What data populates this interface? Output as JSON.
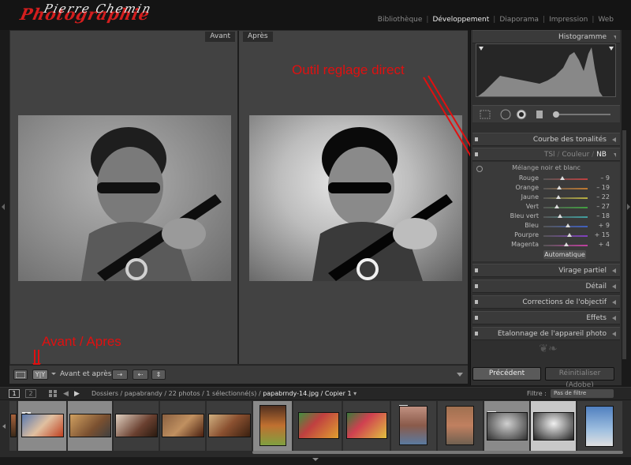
{
  "app": {
    "logo_text": "Photographie",
    "logo_script": "Pierre Chemin"
  },
  "modules": [
    "Bibliothèque",
    "Développement",
    "Diaporama",
    "Impression",
    "Web"
  ],
  "viewer": {
    "before_label": "Avant",
    "after_label": "Après"
  },
  "annotations": {
    "direct_tool": "Outil reglage direct",
    "before_after": "Avant / Apres"
  },
  "toolbar": {
    "view_icon_label": "Y|Y",
    "before_after_label": "Avant et après :"
  },
  "right_panel": {
    "histogram_title": "Histogramme",
    "tone_curve": "Courbe des tonalités",
    "tabs": {
      "tsl": "TSl",
      "sep1": "/",
      "color": "Couleur",
      "sep2": "/",
      "nb": "NB"
    },
    "nb_title": "Mélange noir et blanc",
    "nb_sliders": [
      {
        "label": "Rouge",
        "value": "– 9",
        "pos": 0.42,
        "color": "#c04040"
      },
      {
        "label": "Orange",
        "value": "– 19",
        "pos": 0.36,
        "color": "#c07a30"
      },
      {
        "label": "Jaune",
        "value": "– 22",
        "pos": 0.34,
        "color": "#b8b040"
      },
      {
        "label": "Vert",
        "value": "– 27",
        "pos": 0.31,
        "color": "#40a040"
      },
      {
        "label": "Bleu vert",
        "value": "– 18",
        "pos": 0.37,
        "color": "#40a0a0"
      },
      {
        "label": "Bleu",
        "value": "+ 9",
        "pos": 0.55,
        "color": "#4060c0"
      },
      {
        "label": "Pourpre",
        "value": "+ 15",
        "pos": 0.59,
        "color": "#8040c0"
      },
      {
        "label": "Magenta",
        "value": "+ 4",
        "pos": 0.52,
        "color": "#c040a0"
      }
    ],
    "auto_button": "Automatique",
    "sections": [
      "Virage partiel",
      "Détail",
      "Corrections de l'objectif",
      "Effets",
      "Etalonnage de l'appareil photo"
    ],
    "previous_button": "Précédent",
    "reset_button": "Réinitialiser (Adobe)"
  },
  "filmstrip": {
    "page1": "1",
    "page2": "2",
    "breadcrumb_path": "Dossiers / papabrandy / 22 photos / 1 sélectionné(s) /",
    "breadcrumb_file": "papabrndy-14.jpg / Copier 1",
    "filter_label": "Filtre :",
    "filter_value": "Pas de filtre",
    "stack_badge": "2"
  },
  "colors": {
    "annotation": "#e01010",
    "accent_selected": "#c8c8c8"
  }
}
